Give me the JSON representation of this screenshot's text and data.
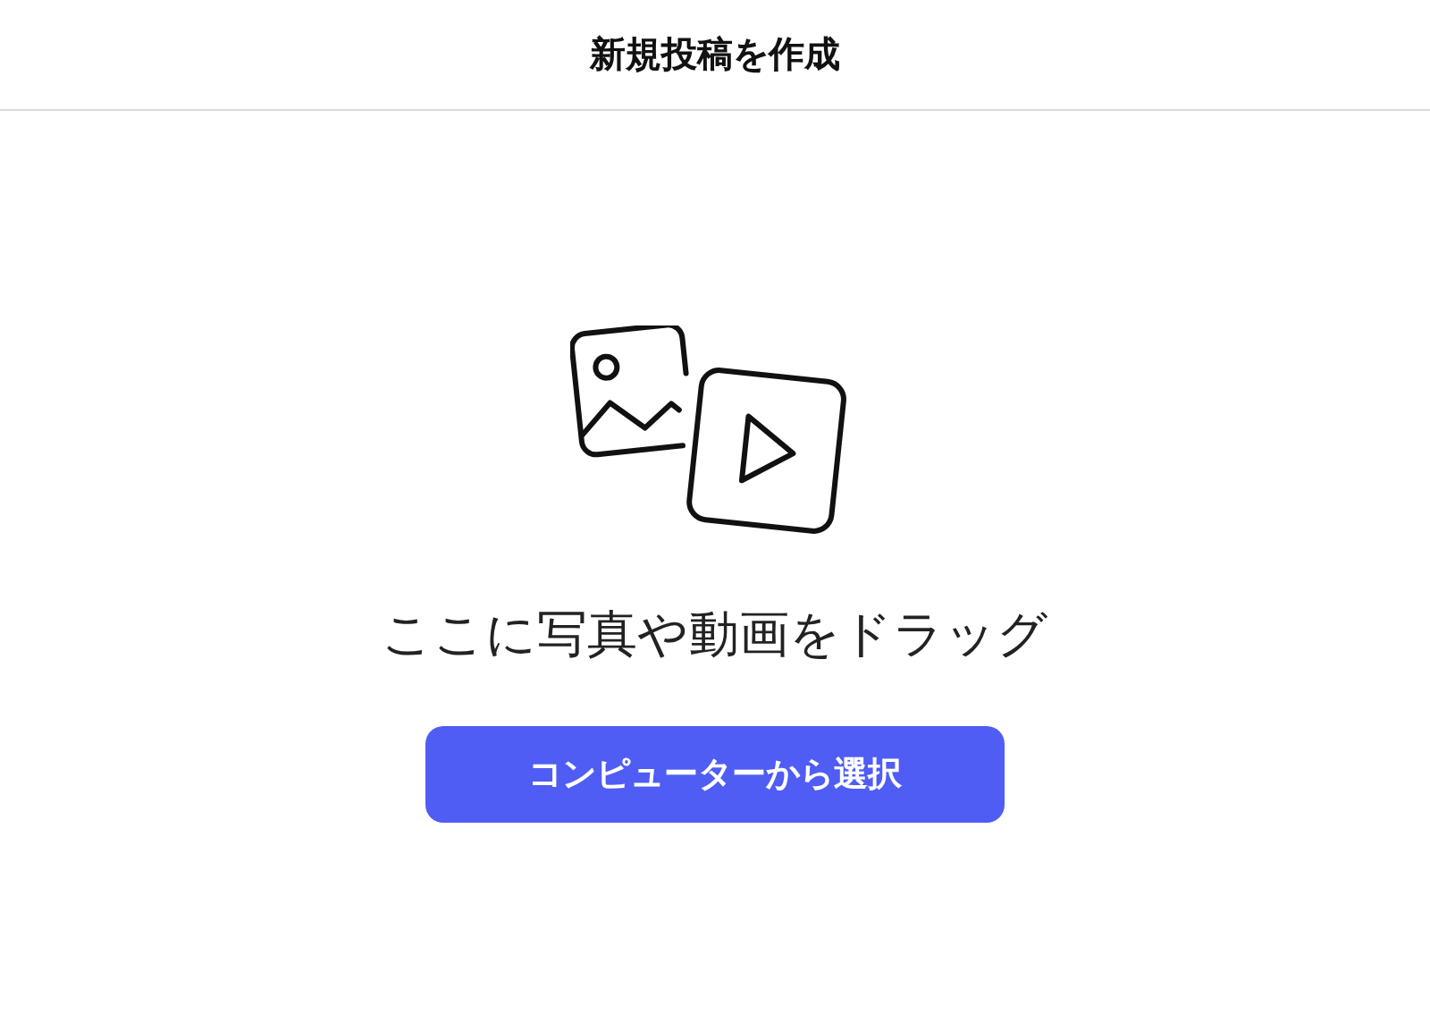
{
  "header": {
    "title": "新規投稿を作成"
  },
  "dropzone": {
    "prompt": "ここに写真や動画をドラッグ",
    "button": "コンピューターから選択"
  }
}
